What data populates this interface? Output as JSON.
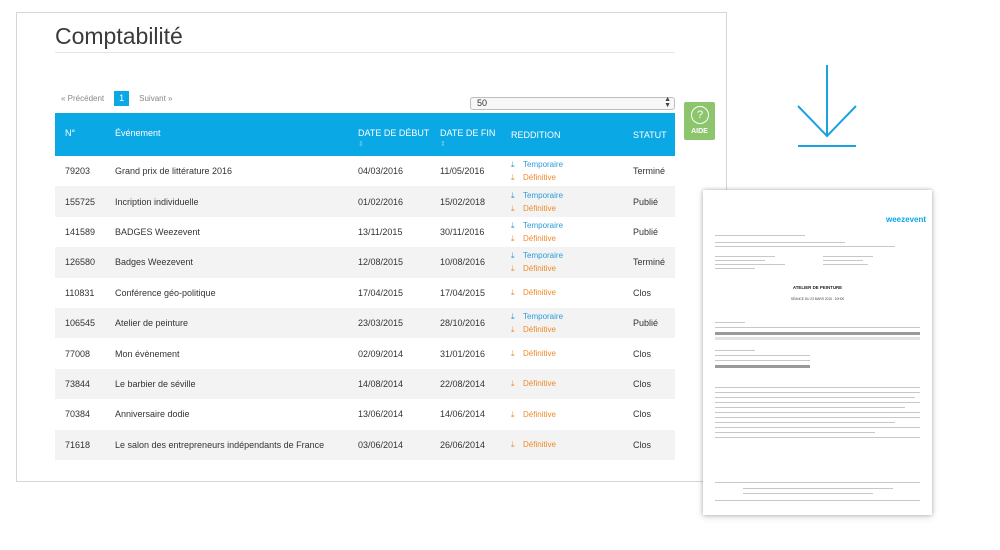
{
  "page": {
    "title": "Comptabilité"
  },
  "pagination": {
    "previous": "« Précédent",
    "current_page": "1",
    "next": "Suivant »",
    "page_size": "50"
  },
  "table": {
    "headers": {
      "no": "N°",
      "event": "Événement",
      "start": "DATE DE DÉBUT",
      "end": "DATE DE FIN",
      "reddition": "REDDITION",
      "status": "STATUT"
    },
    "rows": [
      {
        "no": "79203",
        "event": "Grand prix de littérature 2016",
        "start": "04/03/2016",
        "end": "11/05/2016",
        "temporaire": "Temporaire",
        "definitive": "Définitive",
        "status": "Terminé"
      },
      {
        "no": "155725",
        "event": "Incription individuelle",
        "start": "01/02/2016",
        "end": "15/02/2018",
        "temporaire": "Temporaire",
        "definitive": "Définitive",
        "status": "Publié"
      },
      {
        "no": "141589",
        "event": "BADGES Weezevent",
        "start": "13/11/2015",
        "end": "30/11/2016",
        "temporaire": "Temporaire",
        "definitive": "Définitive",
        "status": "Publié"
      },
      {
        "no": "126580",
        "event": "Badges Weezevent",
        "start": "12/08/2015",
        "end": "10/08/2016",
        "temporaire": "Temporaire",
        "definitive": "Définitive",
        "status": "Terminé"
      },
      {
        "no": "110831",
        "event": "Conférence géo-politique",
        "start": "17/04/2015",
        "end": "17/04/2015",
        "temporaire": "",
        "definitive": "Définitive",
        "status": "Clos"
      },
      {
        "no": "106545",
        "event": "Atelier de peinture",
        "start": "23/03/2015",
        "end": "28/10/2016",
        "temporaire": "Temporaire",
        "definitive": "Définitive",
        "status": "Publié"
      },
      {
        "no": "77008",
        "event": "Mon évènement",
        "start": "02/09/2014",
        "end": "31/01/2016",
        "temporaire": "",
        "definitive": "Définitive",
        "status": "Clos"
      },
      {
        "no": "73844",
        "event": "Le barbier de séville",
        "start": "14/08/2014",
        "end": "22/08/2014",
        "temporaire": "",
        "definitive": "Définitive",
        "status": "Clos"
      },
      {
        "no": "70384",
        "event": "Anniversaire dodie",
        "start": "13/06/2014",
        "end": "14/06/2014",
        "temporaire": "",
        "definitive": "Définitive",
        "status": "Clos"
      },
      {
        "no": "71618",
        "event": "Le salon des entrepreneurs indépendants de France",
        "start": "03/06/2014",
        "end": "26/06/2014",
        "temporaire": "",
        "definitive": "Définitive",
        "status": "Clos"
      }
    ]
  },
  "help_button": {
    "label": "AIDE",
    "icon": "question-icon"
  },
  "document_preview": {
    "logo": "weezevent",
    "title": "ATELIER DE PEINTURE",
    "subtitle": "SÉANCE DU 23 MARS 2015 - 10H00"
  },
  "colors": {
    "accent": "#0aa8e5",
    "temporaire": "#2b9cd8",
    "definitive": "#f08a2c",
    "help": "#8cc56b"
  }
}
